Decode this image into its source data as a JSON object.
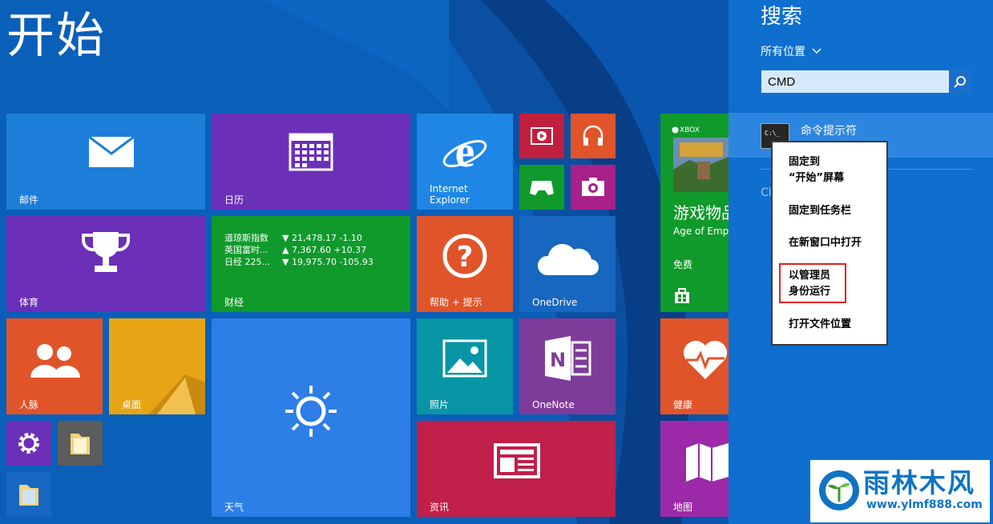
{
  "start": {
    "title": "开始",
    "tiles": {
      "mail": "邮件",
      "calendar": "日历",
      "ie_line1": "Internet",
      "ie_line2": "Explorer",
      "sports": "体育",
      "finance": "财经",
      "help": "帮助 + 提示",
      "onedrive": "OneDrive",
      "people": "人脉",
      "desktop": "桌面",
      "weather": "天气",
      "photos": "照片",
      "onenote": "OneNote",
      "news": "资讯",
      "health": "健康",
      "maps": "地图"
    },
    "finance_rows": [
      {
        "name": "道琼斯指数",
        "value": "▼ 21,478.17 -1.10"
      },
      {
        "name": "英国富时...",
        "value": "▲ 7,367.60 +10.37"
      },
      {
        "name": "日经 225...",
        "value": "▼ 19,975.70 -105.93"
      }
    ],
    "games": {
      "xbox": "XBOX",
      "title": "游戏物品",
      "subtitle": "Age of Emp",
      "price": "免费"
    }
  },
  "search": {
    "title": "搜索",
    "scope": "所有位置",
    "query": "CMD",
    "result_label": "命令提示符",
    "partial_text": "Cl"
  },
  "context_menu": {
    "pin_start_line1": "固定到",
    "pin_start_line2": "“开始”屏幕",
    "pin_taskbar": "固定到任务栏",
    "open_new_window": "在新窗口中打开",
    "run_admin_line1": "以管理员",
    "run_admin_line2": "身份运行",
    "open_location": "打开文件位置"
  },
  "watermark": {
    "name": "雨林木风",
    "url": "www.ylmf888.com"
  },
  "colors": {
    "start_bg": "#0a5fb8",
    "search_bg": "#0e6fce",
    "tile_blue": "#1c7ed8",
    "tile_purple": "#6b2fb8",
    "tile_green": "#0f9a2b",
    "tile_orange": "#e0542a",
    "tile_teal": "#0795a5",
    "tile_magenta": "#7f3b99",
    "tile_crimson": "#c0204a",
    "admin_highlight": "#e02020"
  }
}
